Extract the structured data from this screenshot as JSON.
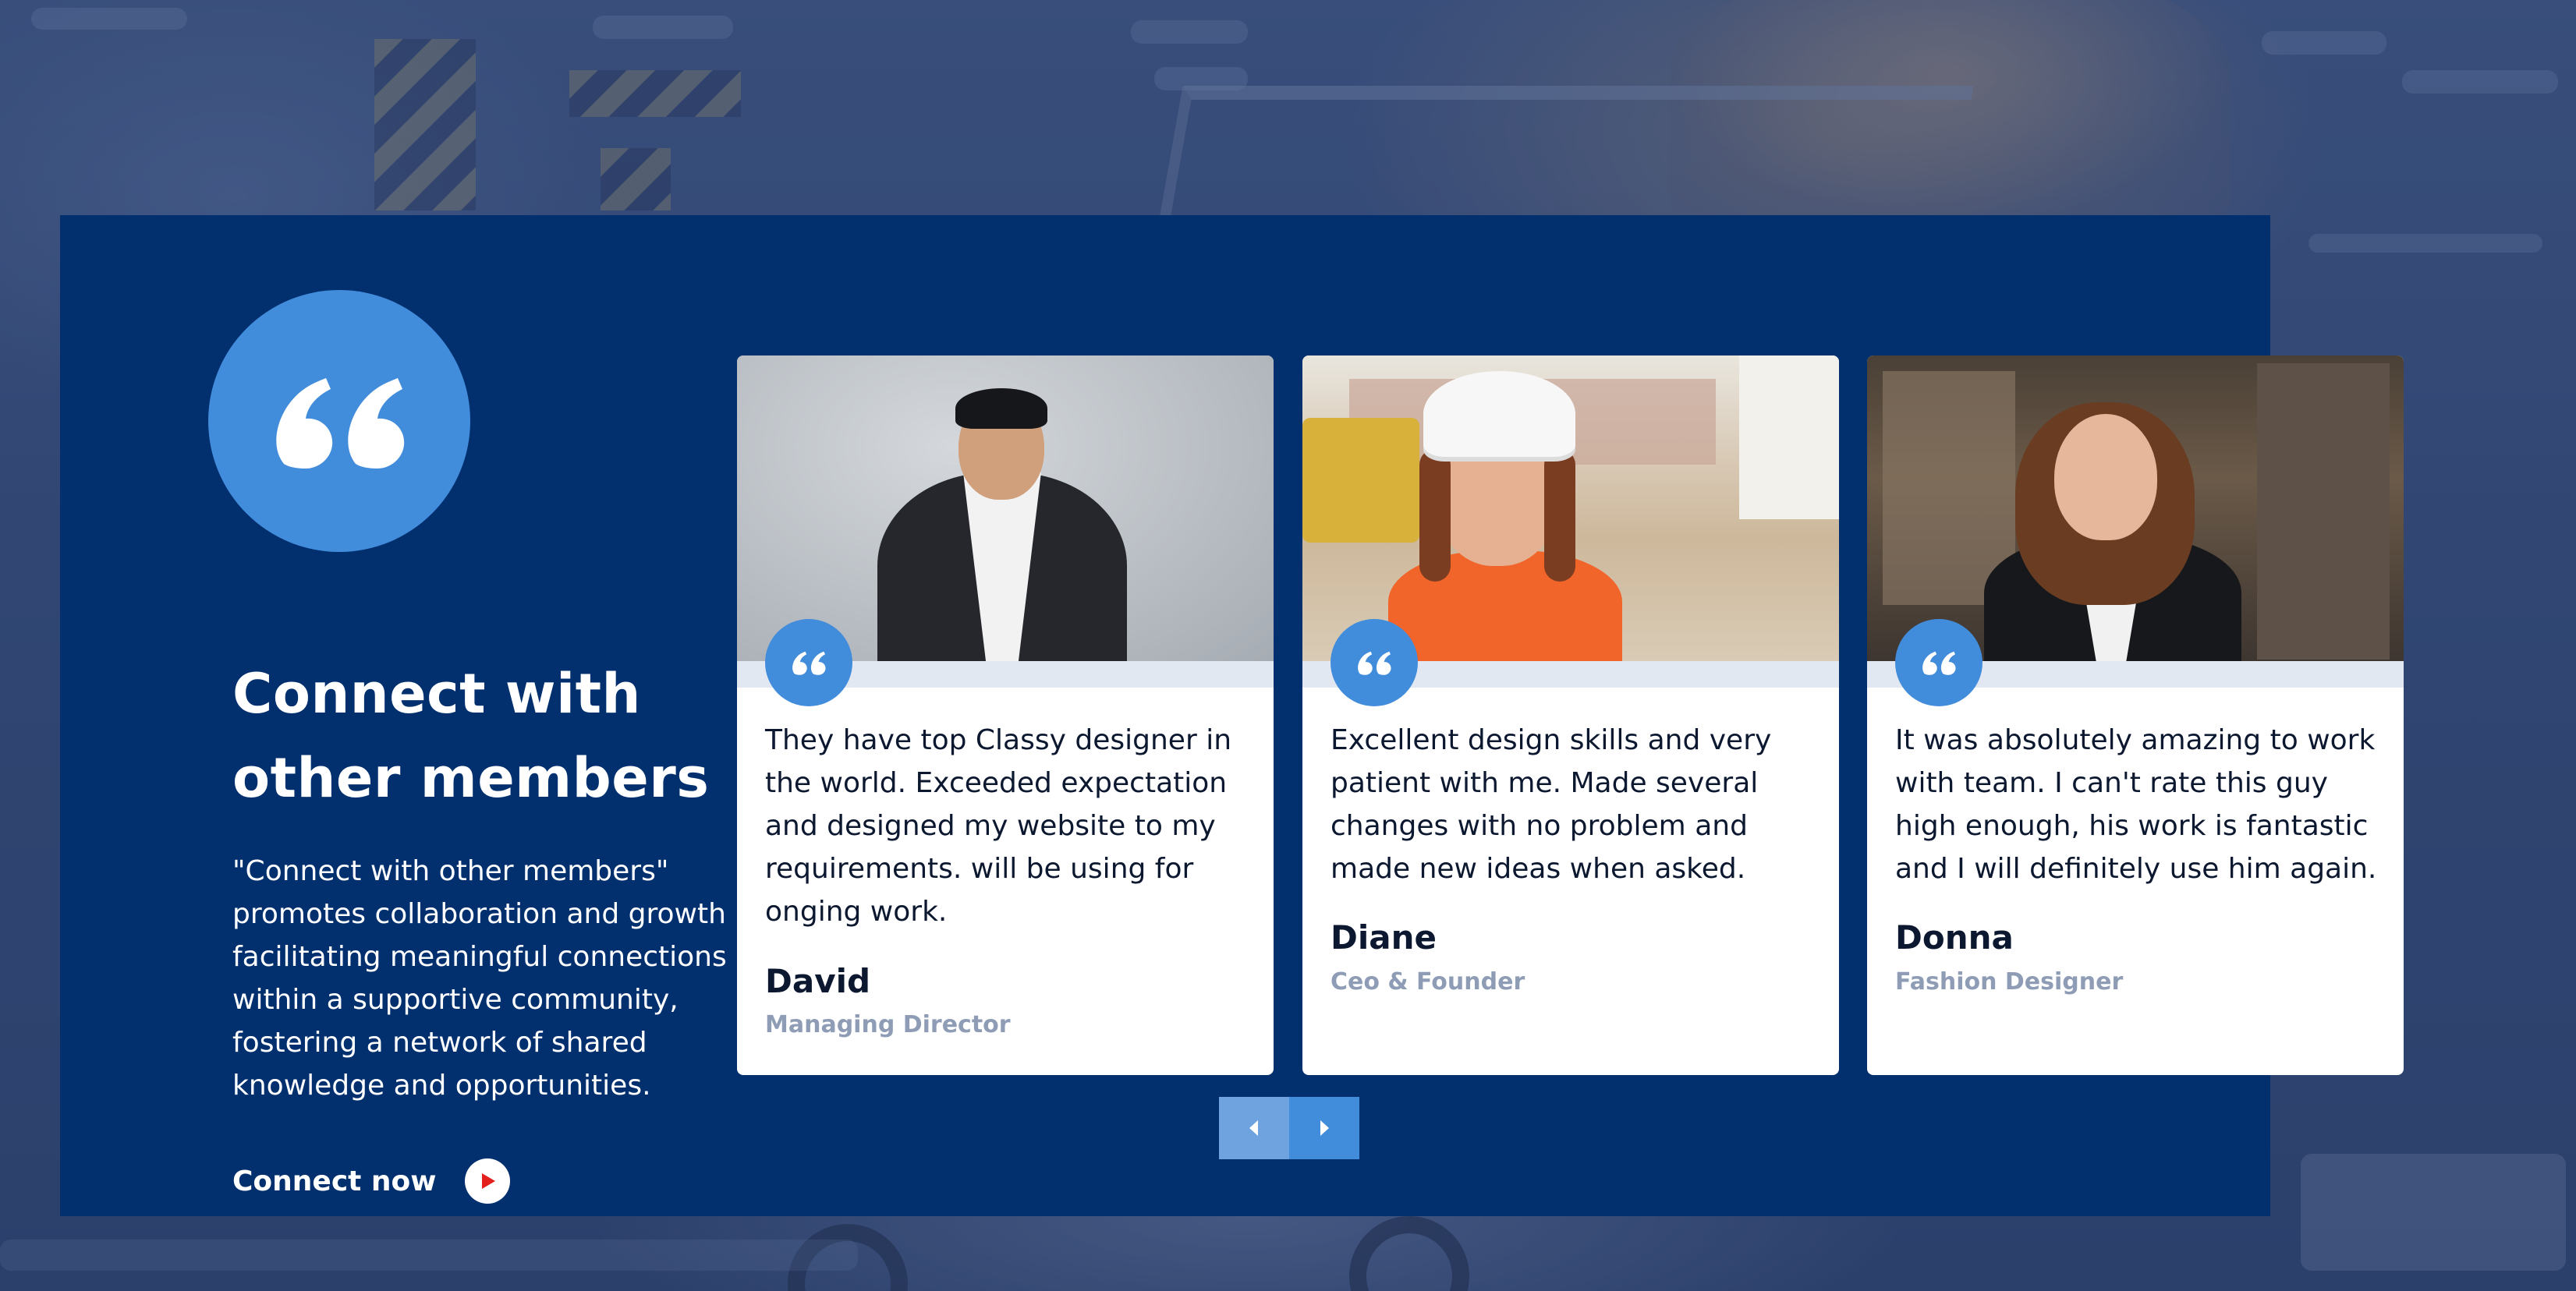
{
  "section": {
    "headline_line1": "Connect with",
    "headline_line2": "other members",
    "description": "\"Connect with other members\" promotes collaboration and growth by facilitating meaningful connections within a supportive community, fostering a network of shared knowledge and opportunities.",
    "cta_label": "Connect now",
    "quote_icon": "quote-icon",
    "cta_icon": "play-icon"
  },
  "testimonials": [
    {
      "quote": "They have top Classy designer in the world. Exceeded expectation and designed my website to my requirements. will be using for onging work.",
      "name": "David",
      "role": "Managing Director"
    },
    {
      "quote": "Excellent design skills and very patient with me. Made several changes with no problem and made new ideas when asked.",
      "name": "Diane",
      "role": "Ceo & Founder"
    },
    {
      "quote": "It was absolutely amazing to work with team. I can't rate this guy high enough, his work is fantastic and I will definitely use him again.",
      "name": "Donna",
      "role": "Fashion Designer"
    }
  ],
  "slider": {
    "prev_icon": "chevron-left-icon",
    "next_icon": "chevron-right-icon"
  },
  "colors": {
    "panel": "#02306f",
    "accent": "#428cdc",
    "accent_light": "#6ea3df",
    "role_text": "#8e9db5",
    "play_icon": "#e3201b"
  }
}
